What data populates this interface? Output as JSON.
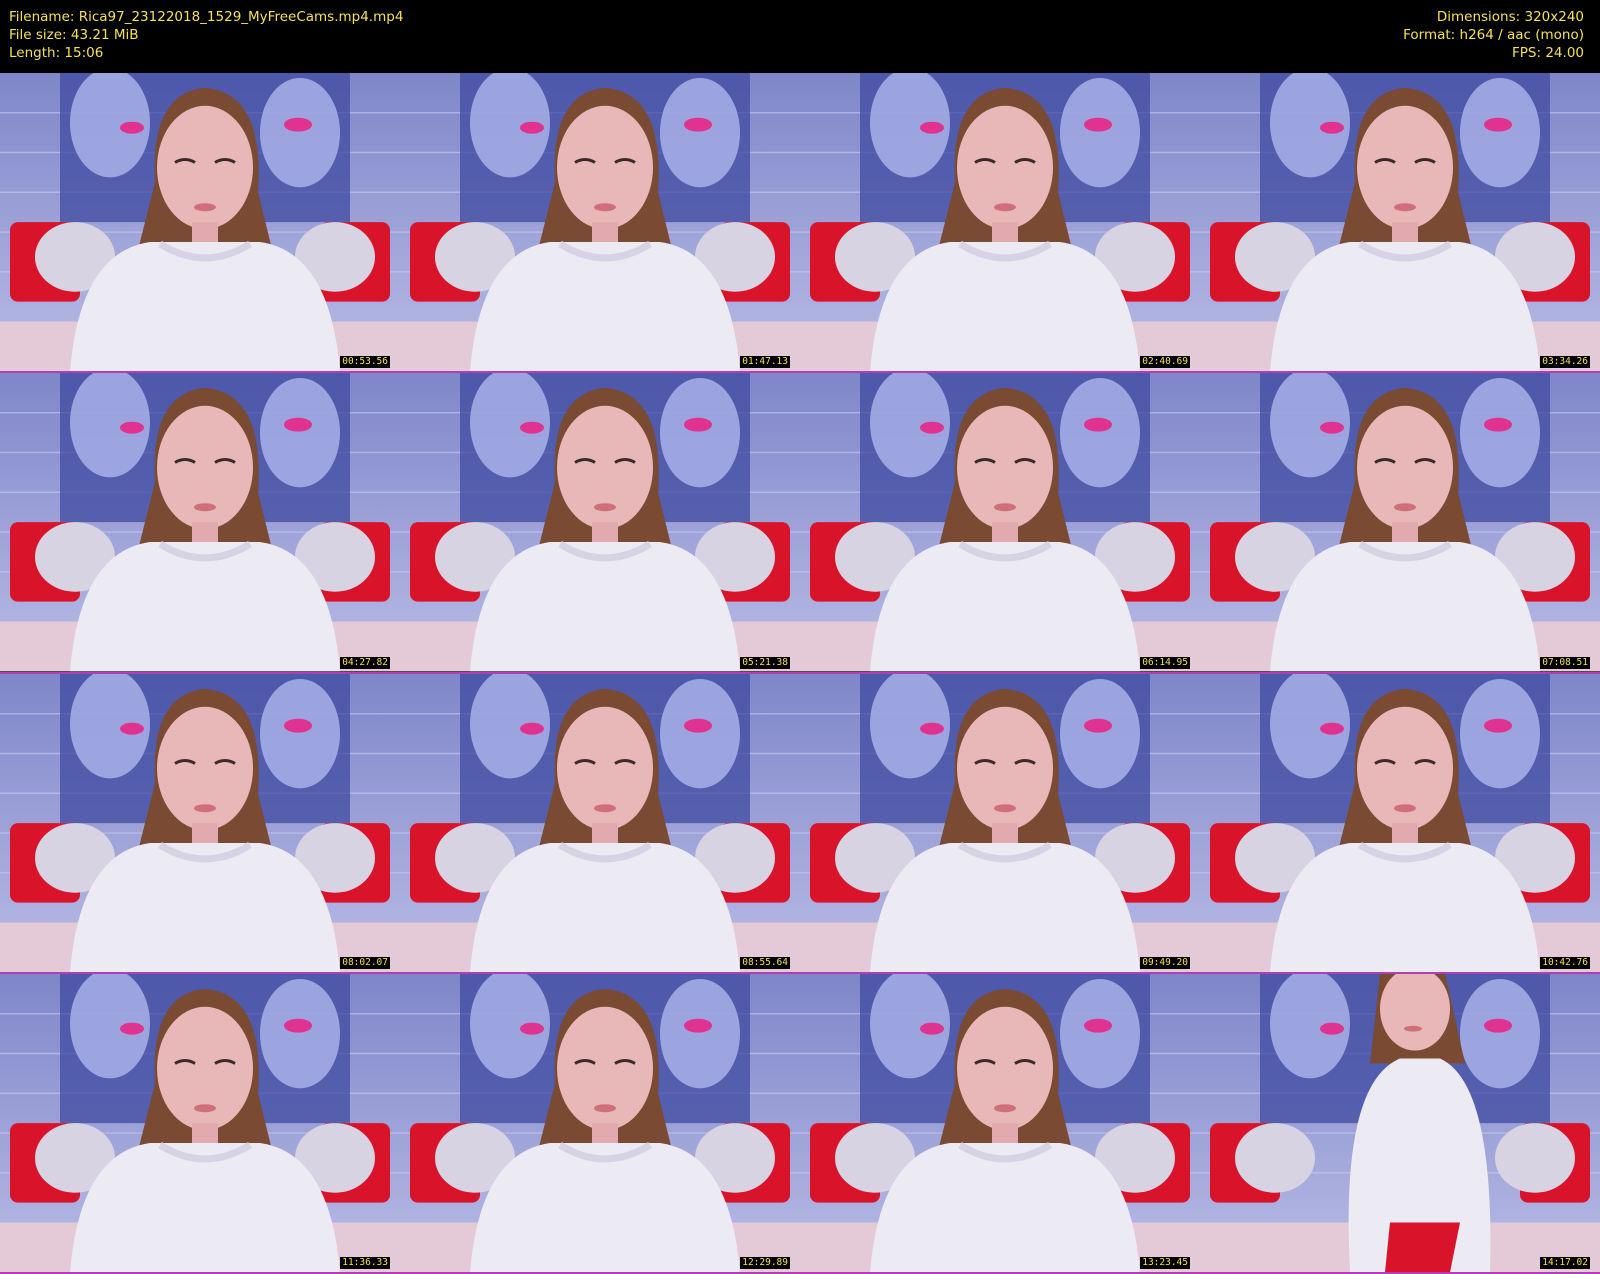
{
  "header": {
    "filename": "Filename: Rica97_23122018_1529_MyFreeCams.mp4.mp4",
    "filesize": "File size: 43.21 MiB",
    "length": "Length: 15:06",
    "dimensions": "Dimensions: 320x240",
    "format": "Format: h264 / aac (mono)",
    "fps": "FPS: 24.00"
  },
  "thumbnails": [
    {
      "time": "00:53.56",
      "pose": "center"
    },
    {
      "time": "01:47.13",
      "pose": "center"
    },
    {
      "time": "02:40.69",
      "pose": "center"
    },
    {
      "time": "03:34.26",
      "pose": "center"
    },
    {
      "time": "04:27.82",
      "pose": "center"
    },
    {
      "time": "05:21.38",
      "pose": "center"
    },
    {
      "time": "06:14.95",
      "pose": "center"
    },
    {
      "time": "07:08.51",
      "pose": "center"
    },
    {
      "time": "08:02.07",
      "pose": "center"
    },
    {
      "time": "08:55.64",
      "pose": "center"
    },
    {
      "time": "09:49.20",
      "pose": "center"
    },
    {
      "time": "10:42.76",
      "pose": "center"
    },
    {
      "time": "11:36.33",
      "pose": "center"
    },
    {
      "time": "12:29.89",
      "pose": "center"
    },
    {
      "time": "13:23.45",
      "pose": "center"
    },
    {
      "time": "14:17.02",
      "pose": "standing"
    }
  ],
  "colors": {
    "header_text": "#f5e05a",
    "separator": "#b13fb3",
    "wall": "#8f94d4",
    "pillow_red": "#d9142a",
    "sweater": "#eceaf3",
    "hair": "#7a4a32",
    "skin": "#e8b7b7"
  }
}
